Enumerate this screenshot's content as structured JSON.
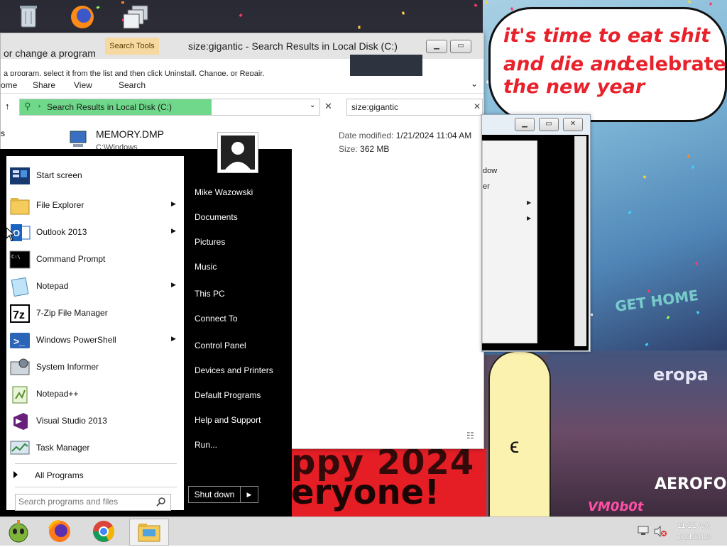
{
  "wallpaper": {
    "speech_lines": [
      "it's time to eat shit",
      "and die and",
      "celebrate",
      "the new year"
    ],
    "banner_line1": "ppy 2024",
    "banner_line2": "eryone!",
    "city_sign1": "GET HOME",
    "city_sign2": "eropa",
    "city_sign3": "AEROFOS",
    "city_sign4": "VM0b0t",
    "colors": {
      "banner_red": "#e51e26",
      "speech_text": "#e8212b"
    }
  },
  "desktop_icons": [
    "recycle-bin-icon",
    "firefox-icon",
    "copy-windows-icon"
  ],
  "explorer": {
    "title": "size:gigantic - Search Results in Local Disk (C:)",
    "search_tools_tab": "Search Tools",
    "behind_text_1": "or change a program",
    "behind_text_2": "a program, select it from the list and then click Uninstall, Change, or Repair.",
    "ribbon_tabs": [
      "ome",
      "Share",
      "View",
      "Search"
    ],
    "address": "Search Results in Local Disk (C:)",
    "search_value": "size:gigantic",
    "file": {
      "name": "MEMORY.DMP",
      "path": "C:\\Windows",
      "date_label": "Date modified:",
      "date_value": "1/21/2024 11:04 AM",
      "size_label": "Size:",
      "size_value": "362 MB"
    },
    "left_cut_text": "s"
  },
  "dialog": {
    "items": [
      "dow",
      "er"
    ]
  },
  "start_menu": {
    "programs": [
      {
        "label": "Start screen",
        "arrow": false
      },
      {
        "label": "File Explorer",
        "arrow": true
      },
      {
        "label": "Outlook 2013",
        "arrow": true
      },
      {
        "label": "Command Prompt",
        "arrow": false
      },
      {
        "label": "Notepad",
        "arrow": true
      },
      {
        "label": "7-Zip File Manager",
        "arrow": false
      },
      {
        "label": "Windows PowerShell",
        "arrow": true
      },
      {
        "label": "System Informer",
        "arrow": false
      },
      {
        "label": "Notepad++",
        "arrow": false
      },
      {
        "label": "Visual Studio 2013",
        "arrow": false
      },
      {
        "label": "Task Manager",
        "arrow": false
      }
    ],
    "all_programs": "All Programs",
    "search_placeholder": "Search programs and files",
    "user": "Mike Wazowski",
    "right_links": [
      "Documents",
      "Pictures",
      "Music",
      "This PC",
      "Connect To",
      "Control Panel",
      "Devices and Printers",
      "Default Programs",
      "Help and Support",
      "Run..."
    ],
    "shutdown": "Shut down"
  },
  "taskbar": {
    "apps": [
      "alien-app-icon",
      "firefox-icon",
      "chrome-icon",
      "file-explorer-icon"
    ],
    "time": "11:21 AM",
    "date": "1/21/2024"
  }
}
